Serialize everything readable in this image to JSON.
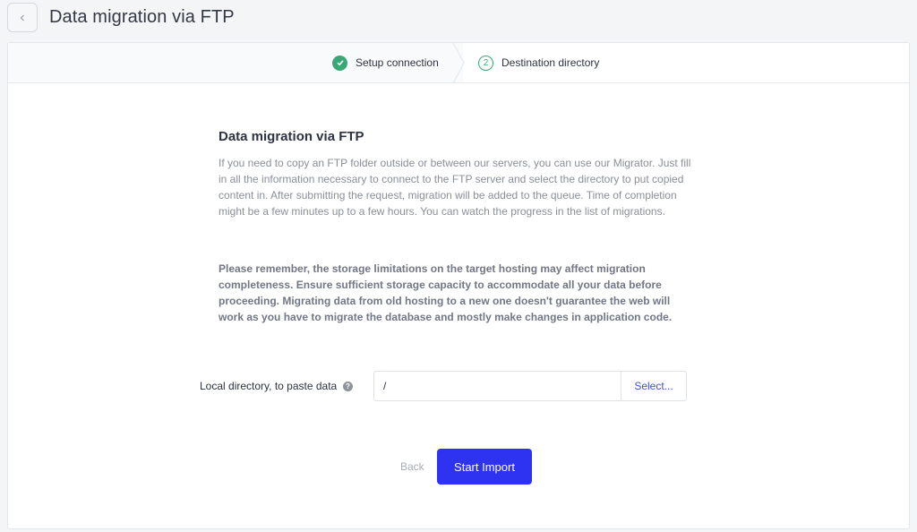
{
  "header": {
    "title": "Data migration via FTP",
    "back_icon": "chevron-left-icon"
  },
  "stepper": {
    "steps": [
      {
        "label": "Setup connection",
        "status": "completed",
        "icon": "check-circle-icon"
      },
      {
        "label": "Destination directory",
        "status": "active",
        "number": "2"
      }
    ],
    "accent_color": "#3aa876"
  },
  "content": {
    "title": "Data migration via FTP",
    "intro": "If you need to copy an FTP folder outside or between our servers, you can use our Migrator. Just fill in all the information necessary to connect to the FTP server and select the directory to put copied content in. After submitting the request, migration will be added to the queue. Time of completion might be a few minutes up to a few hours. You can watch the progress in the list of migrations.",
    "notice": "Please remember, the storage limitations on the target hosting may affect migration completeness. Ensure sufficient storage capacity to accommodate all your data before proceeding. Migrating data from old hosting to a new one doesn't guarantee the web will work as you have to migrate the database and mostly make changes in application code."
  },
  "form": {
    "local_directory_label": "Local directory, to paste data",
    "help_icon": "question-circle-icon",
    "directory_value": "/",
    "select_button_label": "Select..."
  },
  "actions": {
    "back_label": "Back",
    "start_label": "Start Import",
    "primary_color": "#2d33f0"
  }
}
